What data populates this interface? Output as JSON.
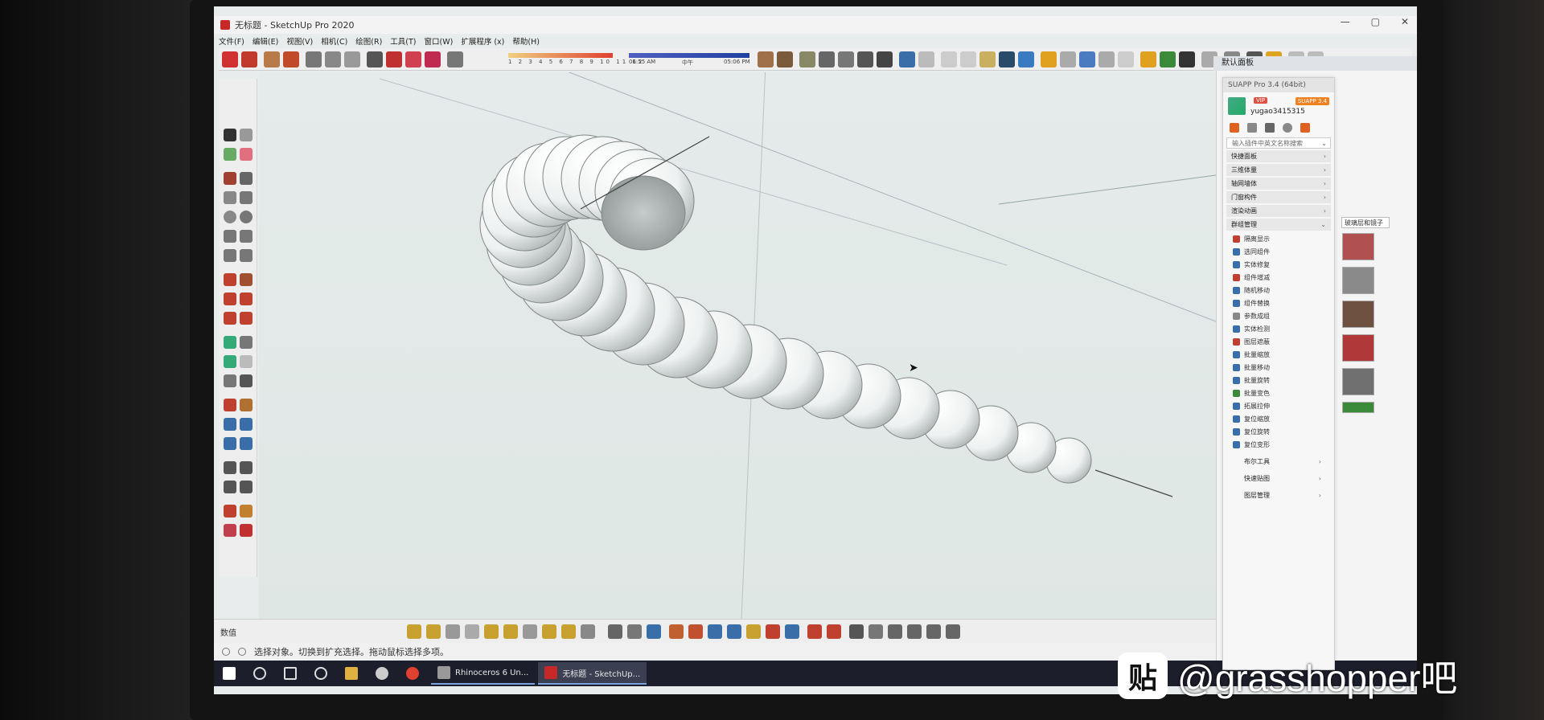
{
  "window": {
    "title": "无标题 - SketchUp Pro 2020",
    "controls": [
      "—",
      "▢",
      "✕"
    ]
  },
  "menu": [
    "文件(F)",
    "编辑(E)",
    "视图(V)",
    "相机(C)",
    "绘图(R)",
    "工具(T)",
    "窗口(W)",
    "扩展程序 (x)",
    "帮助(H)"
  ],
  "shadow_bar": {
    "month_ticks": "1 2 3 4 5 6 7 8 9 10 11 12",
    "time_start": "06:55 AM",
    "time_mid": "中午",
    "time_end": "05:06 PM"
  },
  "bottom": {
    "measurements_label": "数值"
  },
  "status": {
    "text": "选择对象。切换到扩充选择。拖动鼠标选择多项。"
  },
  "taskbar": {
    "apps": [
      "Rhinoceros 6 Un...",
      "无标题 - SketchUp..."
    ]
  },
  "tray": {
    "header": "默认面板"
  },
  "suapp": {
    "title": "SUAPP Pro 3.4 (64bit)",
    "vip_badge": "VIP",
    "version_badge": "SUAPP 3.4",
    "username": "yugao3415315",
    "search_placeholder": "输入插件中英文名称搜索",
    "categories": [
      "快捷面板",
      "三维体量",
      "轴网墙体",
      "门窗构件",
      "渲染动画",
      "群组管理"
    ],
    "group_items": [
      "隔离显示",
      "选同组件",
      "实体修复",
      "组件增减",
      "随机移动",
      "组件替换",
      "参数成组",
      "实体检测",
      "图层遮蔽",
      "批量缩放",
      "批量移动",
      "批量旋转",
      "批量变色",
      "拓展拉伸",
      "复位缩放",
      "复位旋转",
      "复位变形"
    ],
    "footer": [
      "布尔工具",
      "快速贴图",
      "图层管理"
    ]
  },
  "materials": {
    "dropdown_label": "玻璃层和镜子",
    "swatches": [
      "#b05050",
      "#8a8a8a",
      "#6e5040",
      "#b03838",
      "#707070",
      "#3a8a3a"
    ]
  },
  "watermark": {
    "logo_text": "贴",
    "text": "@grasshopper吧"
  }
}
